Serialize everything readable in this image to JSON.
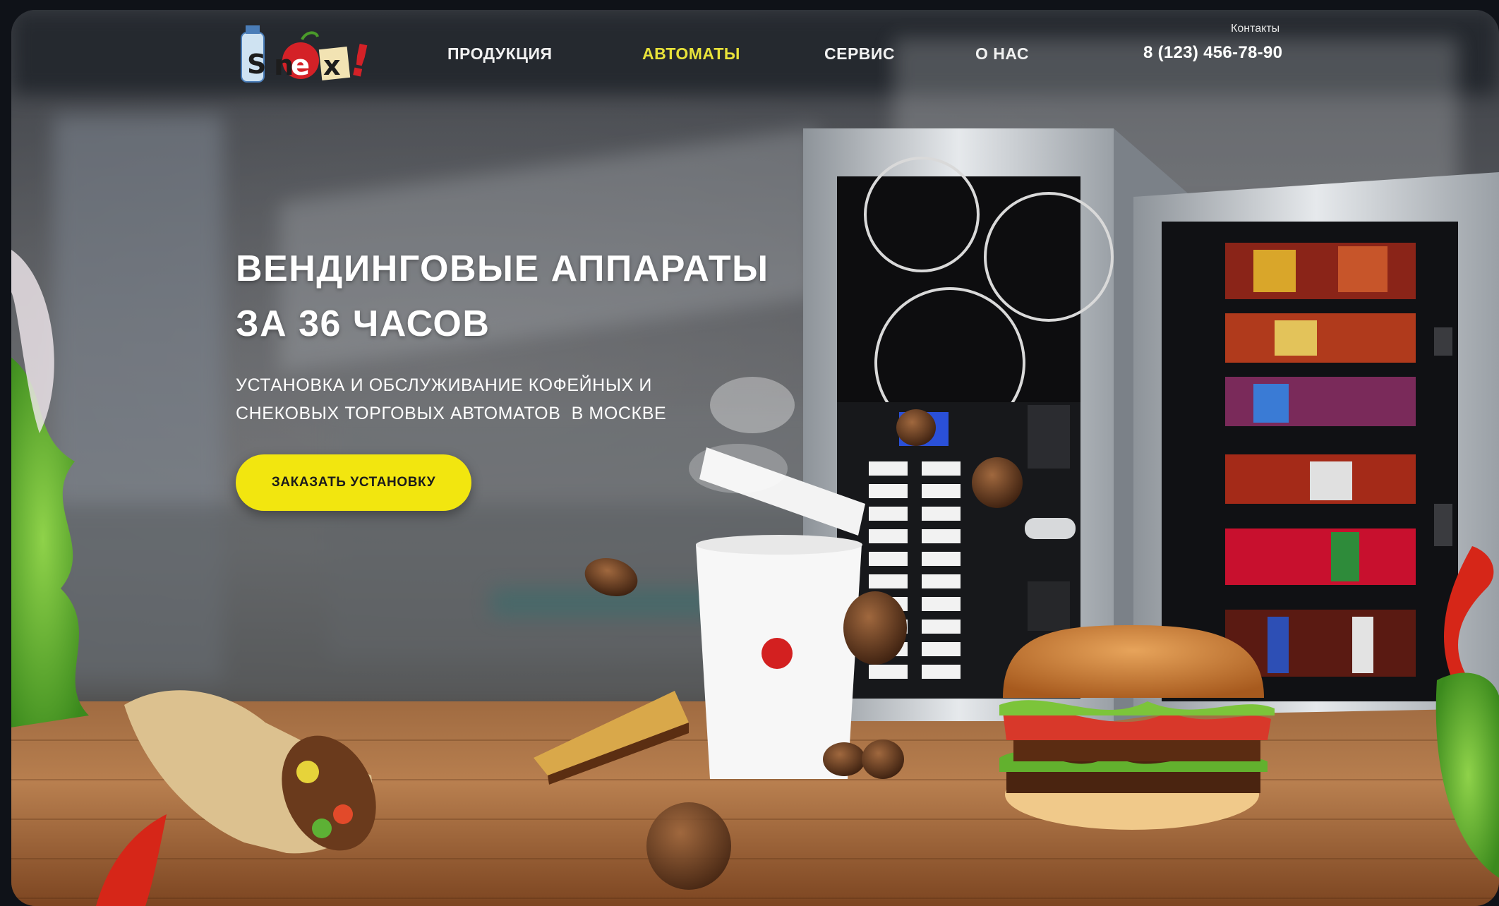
{
  "brand": {
    "logo_text": "Snex!"
  },
  "nav": {
    "items": [
      {
        "label": "ПРОДУКЦИЯ",
        "active": false
      },
      {
        "label": "АВТОМАТЫ",
        "active": true
      },
      {
        "label": "СЕРВИС",
        "active": false
      },
      {
        "label": "О НАС",
        "active": false
      }
    ]
  },
  "contacts": {
    "label": "Контакты",
    "phone": "8 (123) 456-78-90"
  },
  "hero": {
    "title_line1": "ВЕНДИНГОВЫЕ АППАРАТЫ",
    "title_line2": "ЗА 36 ЧАСОВ",
    "subtitle_line1": "УСТАНОВКА И ОБСЛУЖИВАНИЕ КОФЕЙНЫХ И",
    "subtitle_line2": "СНЕКОВЫХ ТОРГОВЫХ АВТОМАТОВ  В МОСКВЕ",
    "cta_label": "ЗАКАЗАТЬ УСТАНОВКУ"
  },
  "colors": {
    "accent": "#f2e60f",
    "nav_active": "#e8e23a",
    "text": "#ffffff"
  }
}
